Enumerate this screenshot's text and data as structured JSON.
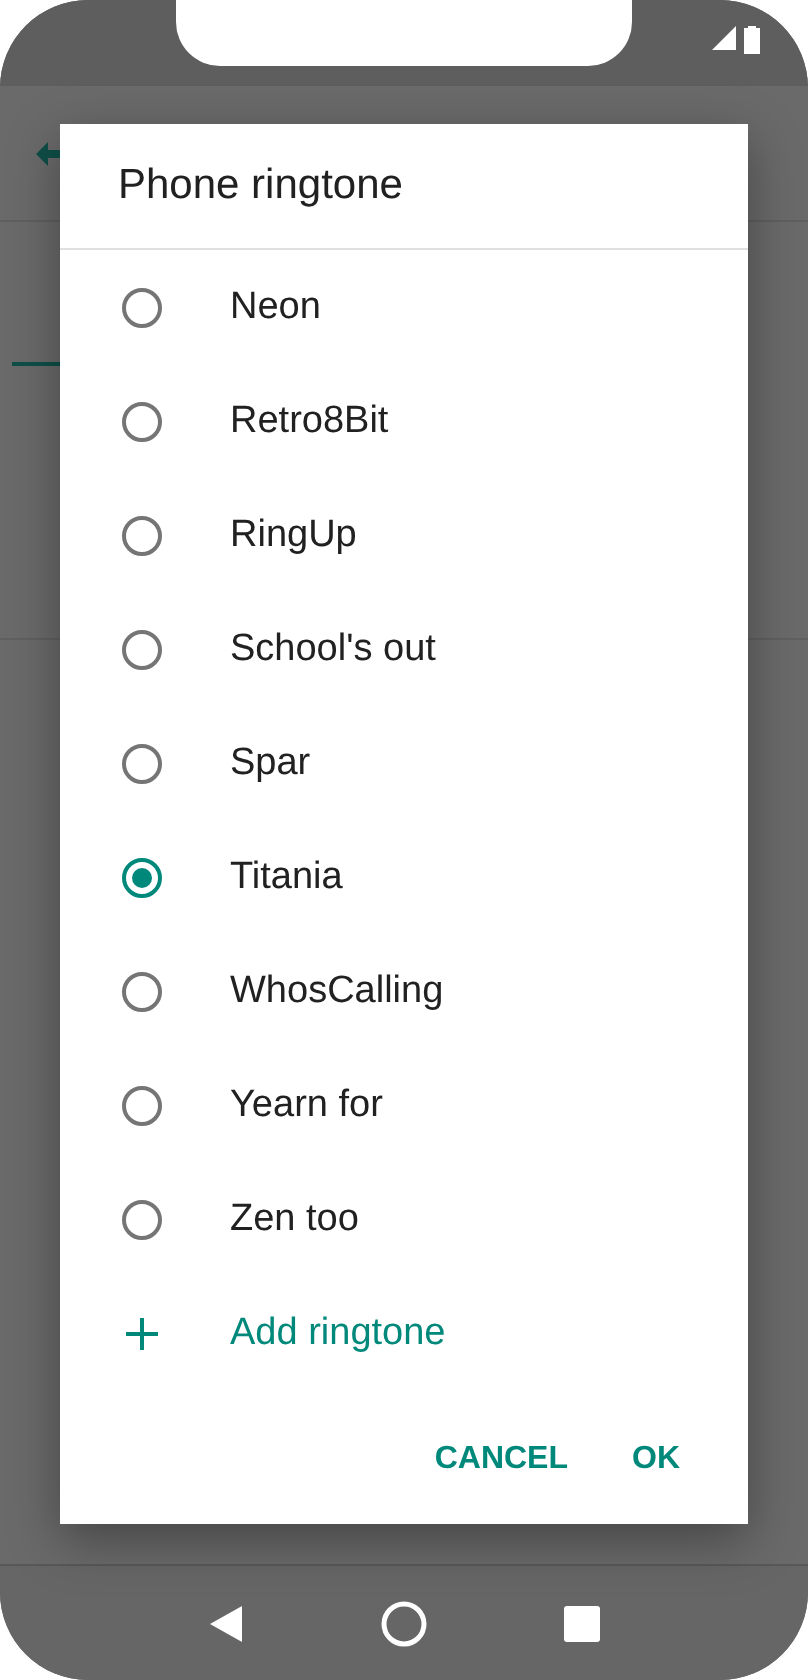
{
  "dialog": {
    "title": "Phone ringtone",
    "options": [
      {
        "label": "Neon",
        "selected": false
      },
      {
        "label": "Retro8Bit",
        "selected": false
      },
      {
        "label": "RingUp",
        "selected": false
      },
      {
        "label": "School's out",
        "selected": false
      },
      {
        "label": "Spar",
        "selected": false
      },
      {
        "label": "Titania",
        "selected": true
      },
      {
        "label": "WhosCalling",
        "selected": false
      },
      {
        "label": "Yearn for",
        "selected": false
      },
      {
        "label": "Zen too",
        "selected": false
      }
    ],
    "add_action": {
      "label": "Add ringtone"
    },
    "buttons": [
      "CANCEL",
      "OK"
    ]
  }
}
